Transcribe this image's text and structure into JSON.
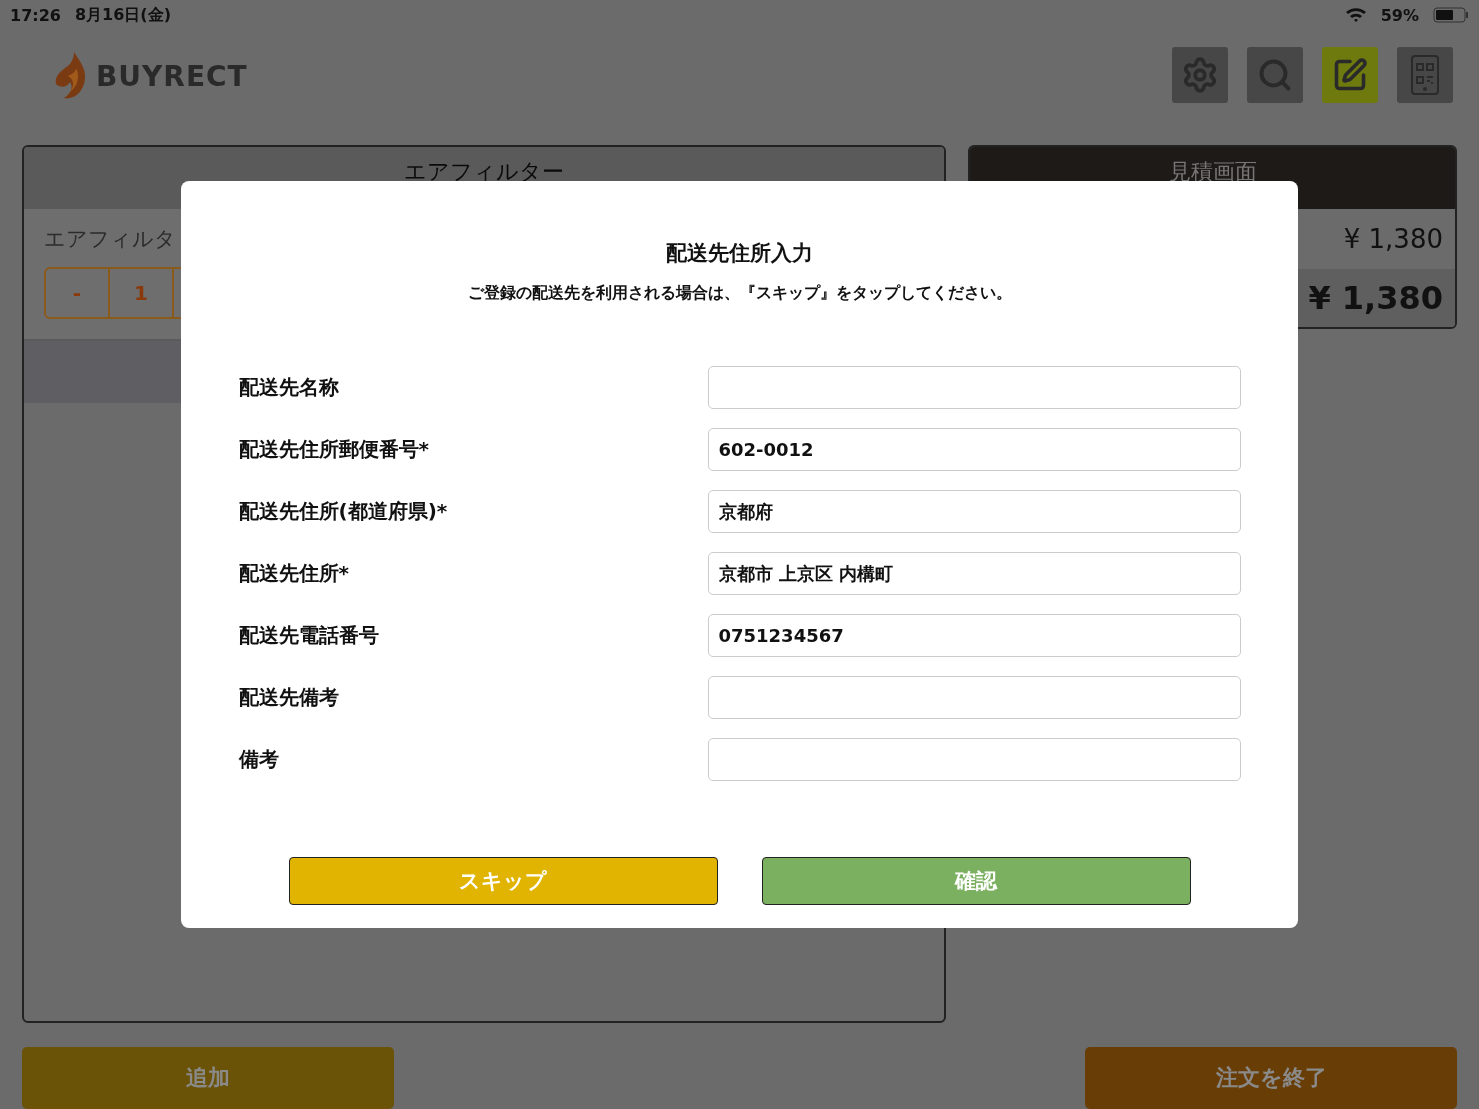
{
  "status_bar": {
    "time": "17:26",
    "date": "8月16日(金)",
    "battery": "59%"
  },
  "header": {
    "logo": "BUYRECT",
    "tools": [
      {
        "kind": "settings",
        "selected": false
      },
      {
        "kind": "search",
        "selected": false
      },
      {
        "kind": "edit",
        "selected": true
      },
      {
        "kind": "qr",
        "selected": false
      }
    ]
  },
  "product_panel": {
    "title": "エアフィルター",
    "item_name": "エアフィルタ",
    "stepper": [
      "-",
      "1"
    ]
  },
  "estimate_panel": {
    "title": "見積画面",
    "subtotal": "¥ 1,380",
    "total": "¥ 1,380"
  },
  "footer": {
    "add_button": "追加",
    "finish_button": "注文を終了"
  },
  "dialog": {
    "title": "配送先住所入力",
    "message": "ご登録の配送先を利用される場合は、『スキップ』をタップしてください。",
    "fields": [
      {
        "label": "配送先名称"
      },
      {
        "label": "配送先住所郵便番号*",
        "value": "602-0012"
      },
      {
        "label": "配送先住所(都道府県)*",
        "value": "京都府"
      },
      {
        "label": "配送先住所*",
        "value": "京都市 上京区 内構町"
      },
      {
        "label": "配送先電話番号",
        "value": "0751234567"
      },
      {
        "label": "配送先備考"
      },
      {
        "label": "備考"
      }
    ],
    "skip_button": "スキップ",
    "confirm_button": "確認"
  }
}
